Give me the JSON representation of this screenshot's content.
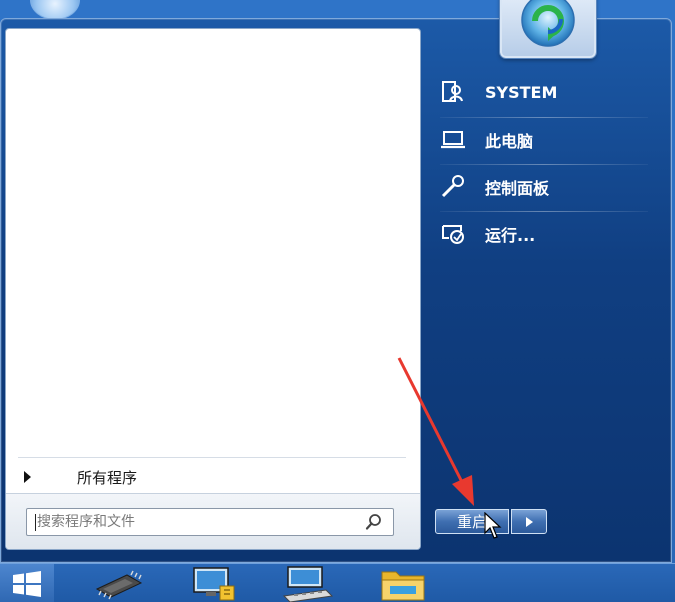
{
  "start_menu": {
    "right_items": [
      {
        "label": "SYSTEM",
        "icon": "user-folder-icon"
      },
      {
        "label": "此电脑",
        "icon": "computer-icon"
      },
      {
        "label": "控制面板",
        "icon": "wrench-icon"
      },
      {
        "label": "运行...",
        "icon": "run-icon"
      }
    ],
    "all_programs_label": "所有程序",
    "search": {
      "placeholder": "搜索程序和文件",
      "value": ""
    },
    "shutdown_label": "重启",
    "user_tile_icon": "user-picture-icon"
  },
  "taskbar": {
    "items": [
      {
        "icon": "windows-start-icon"
      },
      {
        "icon": "chip-icon"
      },
      {
        "icon": "network-computer-icon"
      },
      {
        "icon": "keyboard-monitor-icon"
      },
      {
        "icon": "folder-icon"
      }
    ]
  },
  "colors": {
    "menu_bg": "#103f82",
    "taskbar_bg": "#1f5aa6",
    "annotation_arrow": "#e8392f"
  }
}
